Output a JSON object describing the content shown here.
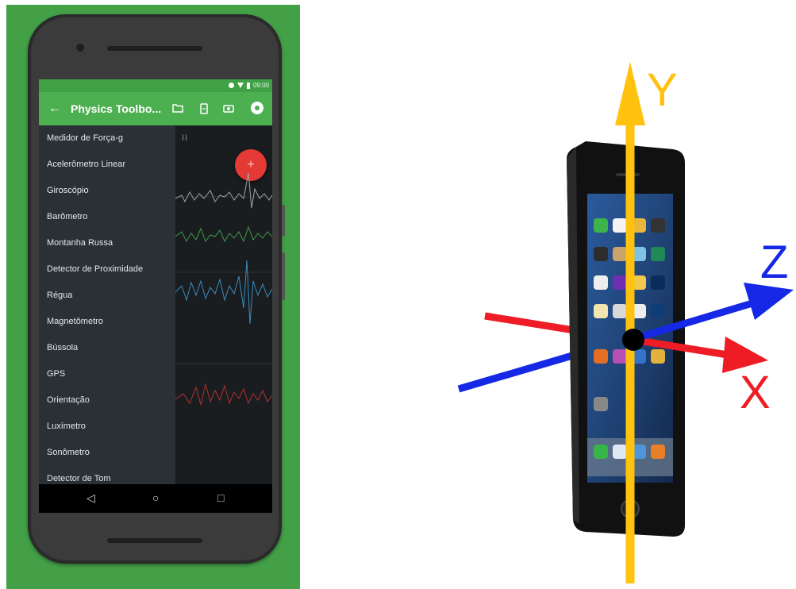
{
  "status_bar": {
    "time": "09:00"
  },
  "app_bar": {
    "back_icon": "back-arrow-icon",
    "title": "Physics Toolbo...",
    "icons": [
      "folder-icon",
      "phone-icon",
      "camera-icon",
      "settings-icon"
    ]
  },
  "drawer": {
    "items": [
      "Medidor de Força-g",
      "Acelerômetro Linear",
      "Giroscópio",
      "Barômetro",
      "Montanha Russa",
      "Detector de Proximidade",
      "Régua",
      "Magnetômetro",
      "Bússola",
      "GPS",
      "Orientação",
      "Luxímetro",
      "Sonômetro",
      "Detector de Tom"
    ]
  },
  "graph": {
    "pause_label": "II",
    "fab_label": "+"
  },
  "nav_bar": {
    "back": "◁",
    "home": "○",
    "recents": "□"
  },
  "axes": {
    "y_label": "Y",
    "z_label": "Z",
    "x_label": "X"
  },
  "colors": {
    "panel_green": "#43a047",
    "appbar_green": "#4caf50",
    "x_axis": "#ee1c24",
    "y_axis": "#ffc20e",
    "z_axis": "#1428e6",
    "fab": "#e53935"
  }
}
